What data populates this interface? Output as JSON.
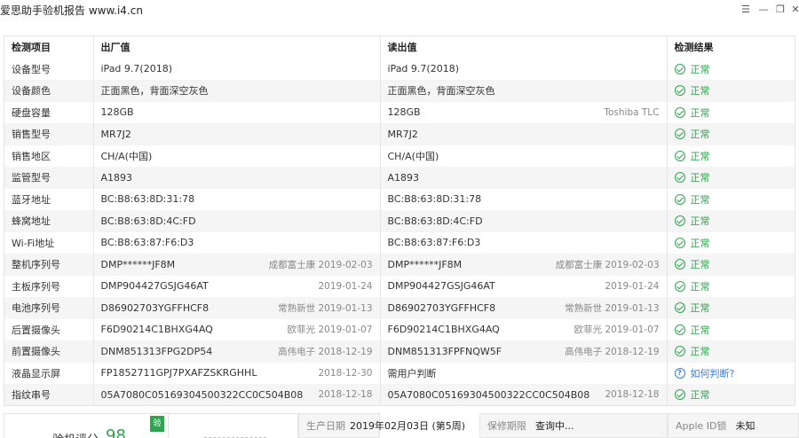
{
  "window": {
    "title": "爱思助手验机报告 www.i4.cn",
    "controls": [
      "menu-icon",
      "minimize-icon",
      "restore-icon",
      "close-icon"
    ]
  },
  "table": {
    "headers": [
      "检测项目",
      "出厂值",
      "读出值",
      "检测结果"
    ],
    "rows": [
      {
        "item": "设备型号",
        "factory": "iPad 9.7(2018)",
        "factory_sub": "",
        "read": "iPad 9.7(2018)",
        "read_sub": "",
        "result": "正常",
        "result_type": "ok"
      },
      {
        "item": "设备颜色",
        "factory": "正面黑色，背面深空灰色",
        "factory_sub": "",
        "read": "正面黑色，背面深空灰色",
        "read_sub": "",
        "result": "正常",
        "result_type": "ok"
      },
      {
        "item": "硬盘容量",
        "factory": "128GB",
        "factory_sub": "",
        "read": "128GB",
        "read_sub": "Toshiba TLC",
        "result": "正常",
        "result_type": "ok"
      },
      {
        "item": "销售型号",
        "factory": "MR7J2",
        "factory_sub": "",
        "read": "MR7J2",
        "read_sub": "",
        "result": "正常",
        "result_type": "ok"
      },
      {
        "item": "销售地区",
        "factory": "CH/A(中国)",
        "factory_sub": "",
        "read": "CH/A(中国)",
        "read_sub": "",
        "result": "正常",
        "result_type": "ok"
      },
      {
        "item": "监管型号",
        "factory": "A1893",
        "factory_sub": "",
        "read": "A1893",
        "read_sub": "",
        "result": "正常",
        "result_type": "ok"
      },
      {
        "item": "蓝牙地址",
        "factory": "BC:B8:63:8D:31:78",
        "factory_sub": "",
        "read": "BC:B8:63:8D:31:78",
        "read_sub": "",
        "result": "正常",
        "result_type": "ok"
      },
      {
        "item": "蜂窝地址",
        "factory": "BC:B8:63:8D:4C:FD",
        "factory_sub": "",
        "read": "BC:B8:63:8D:4C:FD",
        "read_sub": "",
        "result": "正常",
        "result_type": "ok"
      },
      {
        "item": "Wi-Fi地址",
        "factory": "BC:B8:63:87:F6:D3",
        "factory_sub": "",
        "read": "BC:B8:63:87:F6:D3",
        "read_sub": "",
        "result": "正常",
        "result_type": "ok"
      },
      {
        "item": "整机序列号",
        "factory": "DMP******JF8M",
        "factory_sub": "成都富士康 2019-02-03",
        "read": "DMP******JF8M",
        "read_sub": "成都富士康 2019-02-03",
        "result": "正常",
        "result_type": "ok"
      },
      {
        "item": "主板序列号",
        "factory": "DMP904427GSJG46AT",
        "factory_sub": "2019-01-24",
        "read": "DMP904427GSJG46AT",
        "read_sub": "2019-01-24",
        "result": "正常",
        "result_type": "ok"
      },
      {
        "item": "电池序列号",
        "factory": "D86902703YGFFHCF8",
        "factory_sub": "常熟新世 2019-01-13",
        "read": "D86902703YGFFHCF8",
        "read_sub": "常熟新世 2019-01-13",
        "result": "正常",
        "result_type": "ok"
      },
      {
        "item": "后置摄像头",
        "factory": "F6D90214C1BHXG4AQ",
        "factory_sub": "欧菲光 2019-01-07",
        "read": "F6D90214C1BHXG4AQ",
        "read_sub": "欧菲光 2019-01-07",
        "result": "正常",
        "result_type": "ok"
      },
      {
        "item": "前置摄像头",
        "factory": "DNM851313FPG2DP54",
        "factory_sub": "高伟电子 2018-12-19",
        "read": "DNM851313FPFNQW5F",
        "read_sub": "高伟电子 2018-12-19",
        "result": "正常",
        "result_type": "ok"
      },
      {
        "item": "液晶显示屏",
        "factory": "FP1852711GPJ7PXAFZSKRGHHL",
        "factory_sub": "2018-12-30",
        "read": "需用户判断",
        "read_sub": "",
        "result": "如何判断?",
        "result_type": "help"
      },
      {
        "item": "指纹串号",
        "factory": "05A7080C05169304500322CC0C504B08",
        "factory_sub": "2018-12-18",
        "read": "05A7080C05169304500322CC0C504B08",
        "read_sub": "2018-12-18",
        "result": "正常",
        "result_type": "ok"
      }
    ]
  },
  "bottom": {
    "score_label": "验机评分",
    "score_value": "98",
    "badge": "验",
    "production_date_label": "生产日期",
    "production_date_value": "2019年02月03日 (第5周)",
    "warranty_label": "保修期限",
    "warranty_value": "查询中...",
    "appleid_label": "Apple ID锁",
    "appleid_value": "未知"
  },
  "colors": {
    "ok": "#2da44e",
    "help": "#2f7de1",
    "stripe": "#f5f5f5"
  }
}
